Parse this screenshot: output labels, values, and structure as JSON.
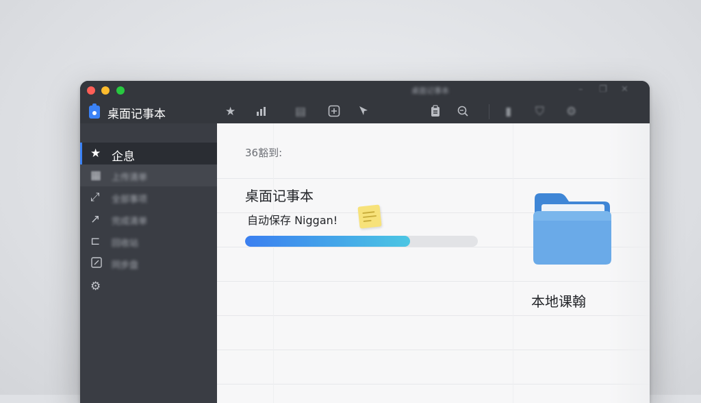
{
  "app": {
    "name": "桌面记事本",
    "window_title_blurred": "桌面记事本"
  },
  "colors": {
    "accent": "#3b82f6",
    "sidebar_bg": "#3a3d44",
    "content_bg": "#f7f7f8",
    "progress_start": "#3b7ff0",
    "progress_end": "#4cc6e3",
    "folder": "#6aaae8"
  },
  "toolbar": {
    "icons": [
      "star-icon",
      "bar-chart-icon",
      "document-icon",
      "add-box-icon",
      "pin-icon",
      "clipboard-icon",
      "search-icon",
      "file-icon",
      "shield-icon",
      "settings-icon"
    ]
  },
  "sidebar": {
    "items": [
      {
        "label": "企息",
        "icon": "star-icon",
        "active": true
      },
      {
        "label": "上传清单",
        "icon": "grid-icon",
        "blurred": true
      },
      {
        "label": "全部事项",
        "icon": "arrow-icon",
        "blurred": true
      },
      {
        "label": "完成清单",
        "icon": "arrow-up-icon",
        "blurred": true
      },
      {
        "label": "回收站",
        "icon": "share-icon",
        "blurred": true
      },
      {
        "label": "同步盘",
        "icon": "edit-icon",
        "blurred": true
      },
      {
        "label": "",
        "icon": "gear-icon"
      }
    ]
  },
  "main": {
    "status": "36豁到:",
    "note_title": "桌面记事本",
    "autosave_text": "自动保存 Niggan!",
    "progress": 0.71,
    "folder_label": "本地课翰"
  }
}
